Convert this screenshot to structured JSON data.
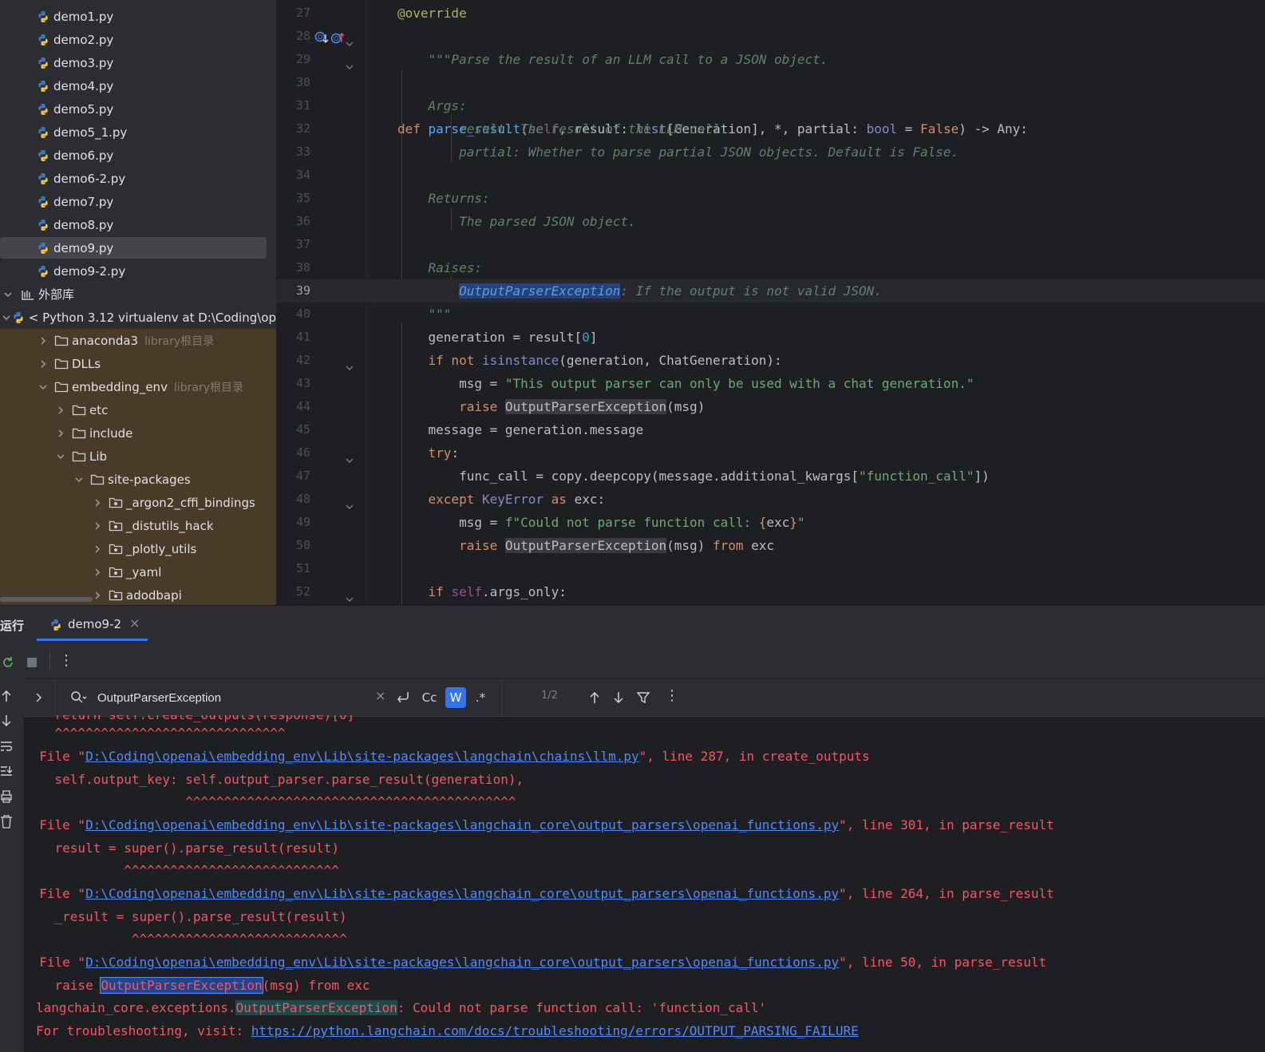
{
  "tree": {
    "files": [
      "demo1.py",
      "demo2.py",
      "demo3.py",
      "demo4.py",
      "demo5.py",
      "demo5_1.py",
      "demo6.py",
      "demo6-2.py",
      "demo7.py",
      "demo8.py",
      "demo9.py",
      "demo9-2.py"
    ],
    "selected_file": "demo9.py",
    "external_libs": "外部库",
    "interpreter": "< Python 3.12 virtualenv at D:\\Coding\\op",
    "anaconda": "anaconda3",
    "anaconda_hint": "library根目录",
    "dlls": "DLLs",
    "embedding_env": "embedding_env",
    "embedding_hint": "library根目录",
    "etc": "etc",
    "include": "include",
    "lib": "Lib",
    "site_packages": "site-packages",
    "pkgs": [
      "_argon2_cffi_bindings",
      "_distutils_hack",
      "_plotly_utils",
      "_yaml",
      "adodbapi"
    ]
  },
  "editor": {
    "line_numbers": [
      "27",
      "28",
      "29",
      "30",
      "31",
      "32",
      "33",
      "34",
      "35",
      "36",
      "37",
      "38",
      "39",
      "40",
      "41",
      "42",
      "43",
      "44",
      "45",
      "46",
      "47",
      "48",
      "49",
      "50",
      "51",
      "52"
    ],
    "current_line": "39"
  },
  "run": {
    "title": "运行",
    "tab": "demo9-2",
    "tab_close": "×",
    "search_query": "OutputParserException",
    "match_case": "Cc",
    "words": "W",
    "regex": ".*",
    "match_count": "1/2"
  },
  "console": {
    "l0": "    ^^^^^^^^^^^^^^^^^^^^^^^^^^^^^^",
    "f1_pre": "  File \"",
    "f1_path": "D:\\Coding\\openai\\embedding_env\\Lib\\site-packages\\langchain\\chains\\llm.py",
    "f1_post": "\", line 287, in create_outputs",
    "c1": "    self.output_key: self.output_parser.parse_result(generation),",
    "u1": "                     ^^^^^^^^^^^^^^^^^^^^^^^^^^^^^^^^^^^^^^^^^^^",
    "f2_pre": "  File \"",
    "f2_path": "D:\\Coding\\openai\\embedding_env\\Lib\\site-packages\\langchain_core\\output_parsers\\openai_functions.py",
    "f2_post": "\", line 301, in parse_result",
    "c2": "    result = super().parse_result(result)",
    "u2": "             ^^^^^^^^^^^^^^^^^^^^^^^^^^^^",
    "f3_pre": "  File \"",
    "f3_path": "D:\\Coding\\openai\\embedding_env\\Lib\\site-packages\\langchain_core\\output_parsers\\openai_functions.py",
    "f3_post": "\", line 264, in parse_result",
    "c3": "    _result = super().parse_result(result)",
    "u3": "              ^^^^^^^^^^^^^^^^^^^^^^^^^^^^",
    "f4_pre": "  File \"",
    "f4_path": "D:\\Coding\\openai\\embedding_env\\Lib\\site-packages\\langchain_core\\output_parsers\\openai_functions.py",
    "f4_post": "\", line 50, in parse_result",
    "c4_pre": "    raise ",
    "c4_match": "OutputParserException",
    "c4_post": "(msg) from exc",
    "e_pre": "langchain_core.exceptions.",
    "e_match": "OutputParserException",
    "e_post": ": Could not parse function call: 'function_call'",
    "t_pre": "For troubleshooting, visit: ",
    "t_link": "https://python.langchain.com/docs/troubleshooting/errors/OUTPUT_PARSING_FAILURE"
  },
  "colors": {
    "accent": "#3574f0",
    "error": "#f75464",
    "link": "#548af7",
    "tree_brown": "#4a3a28"
  }
}
